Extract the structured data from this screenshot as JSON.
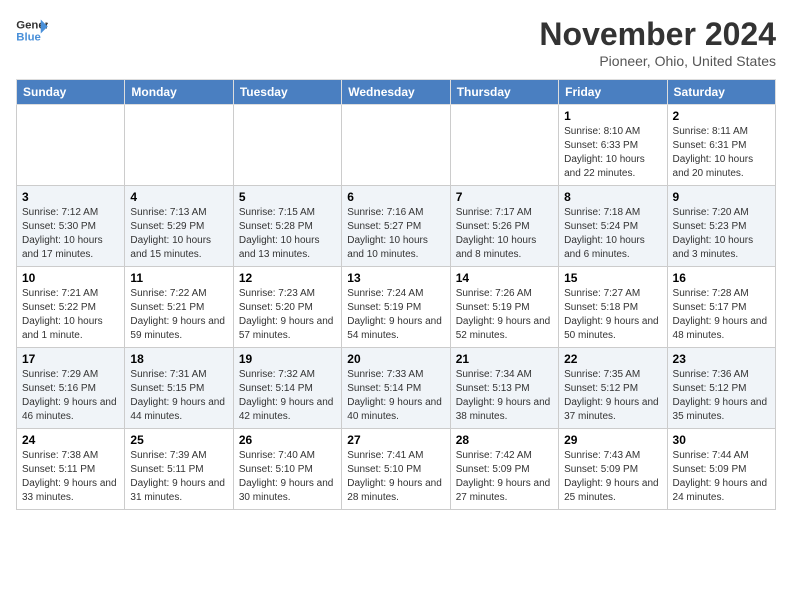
{
  "logo": {
    "line1": "General",
    "line2": "Blue"
  },
  "title": "November 2024",
  "location": "Pioneer, Ohio, United States",
  "days_of_week": [
    "Sunday",
    "Monday",
    "Tuesday",
    "Wednesday",
    "Thursday",
    "Friday",
    "Saturday"
  ],
  "weeks": [
    [
      {
        "day": "",
        "info": ""
      },
      {
        "day": "",
        "info": ""
      },
      {
        "day": "",
        "info": ""
      },
      {
        "day": "",
        "info": ""
      },
      {
        "day": "",
        "info": ""
      },
      {
        "day": "1",
        "info": "Sunrise: 8:10 AM\nSunset: 6:33 PM\nDaylight: 10 hours and 22 minutes."
      },
      {
        "day": "2",
        "info": "Sunrise: 8:11 AM\nSunset: 6:31 PM\nDaylight: 10 hours and 20 minutes."
      }
    ],
    [
      {
        "day": "3",
        "info": "Sunrise: 7:12 AM\nSunset: 5:30 PM\nDaylight: 10 hours and 17 minutes."
      },
      {
        "day": "4",
        "info": "Sunrise: 7:13 AM\nSunset: 5:29 PM\nDaylight: 10 hours and 15 minutes."
      },
      {
        "day": "5",
        "info": "Sunrise: 7:15 AM\nSunset: 5:28 PM\nDaylight: 10 hours and 13 minutes."
      },
      {
        "day": "6",
        "info": "Sunrise: 7:16 AM\nSunset: 5:27 PM\nDaylight: 10 hours and 10 minutes."
      },
      {
        "day": "7",
        "info": "Sunrise: 7:17 AM\nSunset: 5:26 PM\nDaylight: 10 hours and 8 minutes."
      },
      {
        "day": "8",
        "info": "Sunrise: 7:18 AM\nSunset: 5:24 PM\nDaylight: 10 hours and 6 minutes."
      },
      {
        "day": "9",
        "info": "Sunrise: 7:20 AM\nSunset: 5:23 PM\nDaylight: 10 hours and 3 minutes."
      }
    ],
    [
      {
        "day": "10",
        "info": "Sunrise: 7:21 AM\nSunset: 5:22 PM\nDaylight: 10 hours and 1 minute."
      },
      {
        "day": "11",
        "info": "Sunrise: 7:22 AM\nSunset: 5:21 PM\nDaylight: 9 hours and 59 minutes."
      },
      {
        "day": "12",
        "info": "Sunrise: 7:23 AM\nSunset: 5:20 PM\nDaylight: 9 hours and 57 minutes."
      },
      {
        "day": "13",
        "info": "Sunrise: 7:24 AM\nSunset: 5:19 PM\nDaylight: 9 hours and 54 minutes."
      },
      {
        "day": "14",
        "info": "Sunrise: 7:26 AM\nSunset: 5:19 PM\nDaylight: 9 hours and 52 minutes."
      },
      {
        "day": "15",
        "info": "Sunrise: 7:27 AM\nSunset: 5:18 PM\nDaylight: 9 hours and 50 minutes."
      },
      {
        "day": "16",
        "info": "Sunrise: 7:28 AM\nSunset: 5:17 PM\nDaylight: 9 hours and 48 minutes."
      }
    ],
    [
      {
        "day": "17",
        "info": "Sunrise: 7:29 AM\nSunset: 5:16 PM\nDaylight: 9 hours and 46 minutes."
      },
      {
        "day": "18",
        "info": "Sunrise: 7:31 AM\nSunset: 5:15 PM\nDaylight: 9 hours and 44 minutes."
      },
      {
        "day": "19",
        "info": "Sunrise: 7:32 AM\nSunset: 5:14 PM\nDaylight: 9 hours and 42 minutes."
      },
      {
        "day": "20",
        "info": "Sunrise: 7:33 AM\nSunset: 5:14 PM\nDaylight: 9 hours and 40 minutes."
      },
      {
        "day": "21",
        "info": "Sunrise: 7:34 AM\nSunset: 5:13 PM\nDaylight: 9 hours and 38 minutes."
      },
      {
        "day": "22",
        "info": "Sunrise: 7:35 AM\nSunset: 5:12 PM\nDaylight: 9 hours and 37 minutes."
      },
      {
        "day": "23",
        "info": "Sunrise: 7:36 AM\nSunset: 5:12 PM\nDaylight: 9 hours and 35 minutes."
      }
    ],
    [
      {
        "day": "24",
        "info": "Sunrise: 7:38 AM\nSunset: 5:11 PM\nDaylight: 9 hours and 33 minutes."
      },
      {
        "day": "25",
        "info": "Sunrise: 7:39 AM\nSunset: 5:11 PM\nDaylight: 9 hours and 31 minutes."
      },
      {
        "day": "26",
        "info": "Sunrise: 7:40 AM\nSunset: 5:10 PM\nDaylight: 9 hours and 30 minutes."
      },
      {
        "day": "27",
        "info": "Sunrise: 7:41 AM\nSunset: 5:10 PM\nDaylight: 9 hours and 28 minutes."
      },
      {
        "day": "28",
        "info": "Sunrise: 7:42 AM\nSunset: 5:09 PM\nDaylight: 9 hours and 27 minutes."
      },
      {
        "day": "29",
        "info": "Sunrise: 7:43 AM\nSunset: 5:09 PM\nDaylight: 9 hours and 25 minutes."
      },
      {
        "day": "30",
        "info": "Sunrise: 7:44 AM\nSunset: 5:09 PM\nDaylight: 9 hours and 24 minutes."
      }
    ]
  ]
}
